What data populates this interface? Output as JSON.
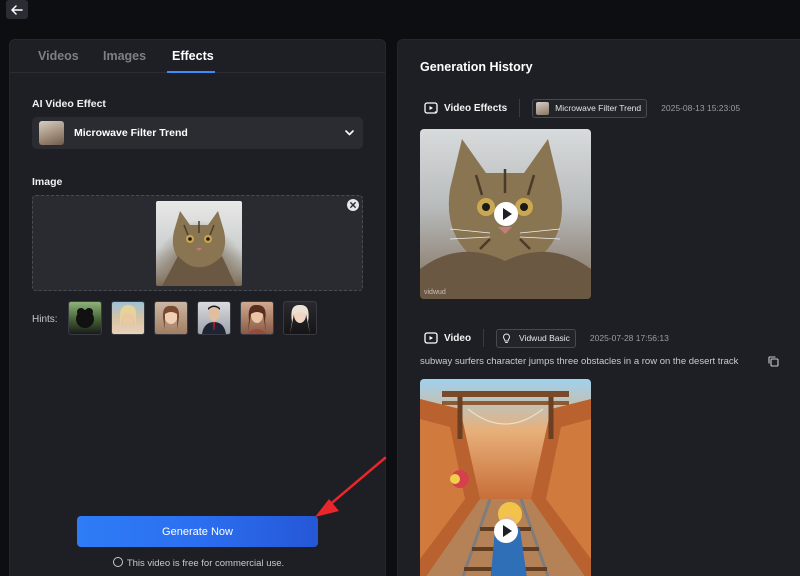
{
  "tabs": [
    {
      "label": "Videos"
    },
    {
      "label": "Images"
    },
    {
      "label": "Effects"
    }
  ],
  "effect": {
    "section_label": "AI Video Effect",
    "selected": "Microwave Filter Trend"
  },
  "image": {
    "section_label": "Image"
  },
  "hints": {
    "label": "Hints:"
  },
  "generate": {
    "button_label": "Generate Now",
    "note": "This video is free for commercial use."
  },
  "history": {
    "title": "Generation History",
    "items": [
      {
        "type": "Video Effects",
        "model": "Microwave Filter Trend",
        "time": "2025-08-13 15:23:05",
        "watermark": "vidwud"
      },
      {
        "type": "Video",
        "model": "Vidwud Basic",
        "time": "2025-07-28 17:56:13",
        "prompt": "subway surfers character jumps three obstacles in a row on the desert track"
      }
    ]
  },
  "colors": {
    "accent": "#3d8bff",
    "button_gradient_start": "#2e7cf6",
    "button_gradient_end": "#2557d6",
    "annotation_arrow": "#e8262b"
  }
}
